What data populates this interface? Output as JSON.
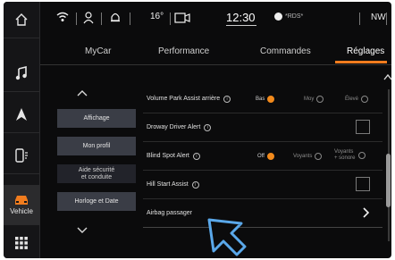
{
  "rail": {
    "vehicle_label": "Vehicle"
  },
  "status": {
    "temperature": "16°",
    "time": "12:30",
    "rds": "*RDS*",
    "compass": "NW"
  },
  "tabs": [
    {
      "label": "MyCar"
    },
    {
      "label": "Performance"
    },
    {
      "label": "Commandes"
    },
    {
      "label": "Réglages"
    }
  ],
  "menu": {
    "items": [
      {
        "label": "Affichage"
      },
      {
        "label": "Mon profil"
      },
      {
        "label": "Aide sécurité\net conduite"
      },
      {
        "label": "Horloge et Date"
      }
    ]
  },
  "settings": [
    {
      "label": "Volume Park Assist arrière",
      "options": [
        "Bas",
        "Moy",
        "Élevé"
      ],
      "selected": "Bas"
    },
    {
      "label": "Droway Driver Alert"
    },
    {
      "label": "Blind Spot Alert",
      "options": [
        "Off",
        "Voyants",
        "Voyants\n+ sonore"
      ],
      "selected": "Off"
    },
    {
      "label": "Hill Start Assist"
    },
    {
      "label": "Airbag passager"
    }
  ],
  "colors": {
    "accent": "#f07c1e",
    "background": "#0b0b0c",
    "menu_button": "#3a3d46"
  }
}
